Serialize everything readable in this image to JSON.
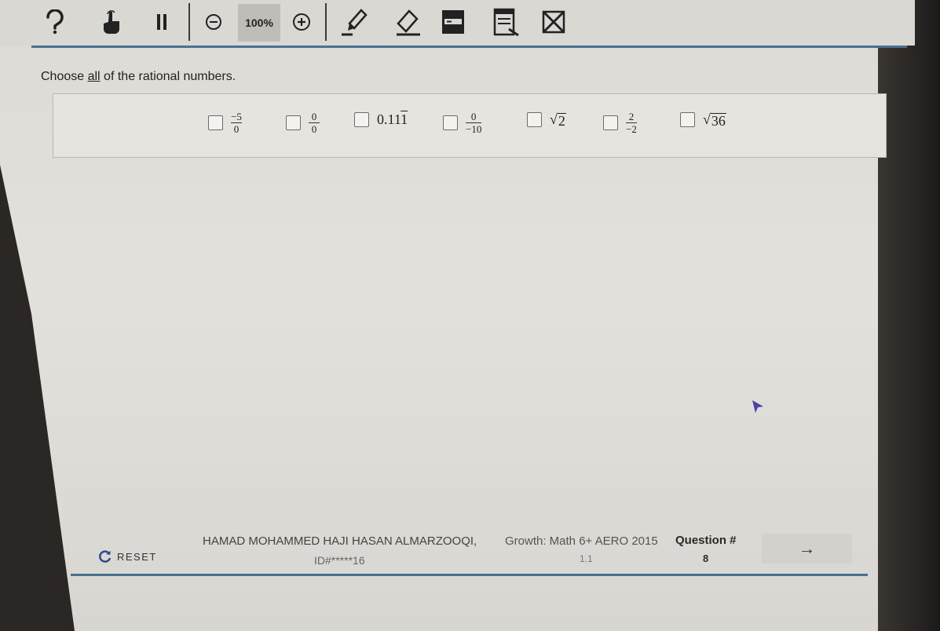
{
  "toolbar": {
    "zoom_level": "100%",
    "buttons": [
      "help-icon",
      "hand-pointer-icon",
      "pause-icon",
      "zoom-out-icon",
      "zoom-in-icon",
      "pen-icon",
      "eraser-icon",
      "line-reader-icon",
      "notepad-icon",
      "answer-eliminator-icon"
    ]
  },
  "question": {
    "prompt_before": "Choose ",
    "prompt_emph": "all",
    "prompt_after": " of the rational numbers."
  },
  "choices": [
    {
      "kind": "fraction",
      "num": "−5",
      "den": "0"
    },
    {
      "kind": "fraction",
      "num": "0",
      "den": "0"
    },
    {
      "kind": "plain",
      "text": "0.11",
      "overline": "1"
    },
    {
      "kind": "fraction",
      "num": "0",
      "den": "−10"
    },
    {
      "kind": "radical",
      "radicand": "2"
    },
    {
      "kind": "fraction",
      "num": "2",
      "den": "−2"
    },
    {
      "kind": "radical",
      "radicand": "36"
    }
  ],
  "footer": {
    "reset_label": "RESET",
    "student_name": "HAMAD MOHAMMED HAJI HASAN ALMARZOOQI,",
    "student_id": "ID#*****16",
    "course": "Growth: Math 6+ AERO 2015",
    "course_sub": "1.1",
    "question_label": "Question #",
    "question_number": "8",
    "next_symbol": "→"
  },
  "colors": {
    "accent_rule": "#4a6f8f"
  }
}
